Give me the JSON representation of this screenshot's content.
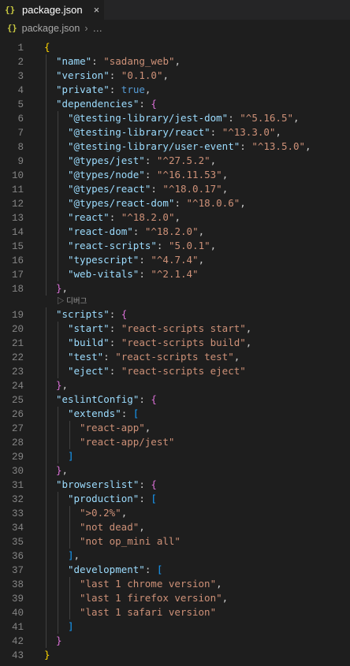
{
  "tab": {
    "icon": "{}",
    "title": "package.json",
    "close": "×"
  },
  "breadcrumb": {
    "icon": "{}",
    "file": "package.json",
    "separator": "›",
    "more": "…"
  },
  "codelens": "▷ 디버그",
  "colors": {
    "background": "#1e1e1e",
    "key": "#9cdcfe",
    "string": "#ce9178",
    "keyword": "#569cd6",
    "bracket_level1": "#ffd700",
    "bracket_level2": "#da70d6",
    "bracket_level3": "#179fff"
  },
  "lines": [
    {
      "n": "1",
      "indent": 0,
      "tokens": [
        [
          "b1",
          "{"
        ]
      ]
    },
    {
      "n": "2",
      "indent": 1,
      "tokens": [
        [
          "key",
          "\"name\""
        ],
        [
          "punc",
          ": "
        ],
        [
          "str",
          "\"sadang_web\""
        ],
        [
          "punc",
          ","
        ]
      ]
    },
    {
      "n": "3",
      "indent": 1,
      "tokens": [
        [
          "key",
          "\"version\""
        ],
        [
          "punc",
          ": "
        ],
        [
          "str",
          "\"0.1.0\""
        ],
        [
          "punc",
          ","
        ]
      ]
    },
    {
      "n": "4",
      "indent": 1,
      "tokens": [
        [
          "key",
          "\"private\""
        ],
        [
          "punc",
          ": "
        ],
        [
          "kw",
          "true"
        ],
        [
          "punc",
          ","
        ]
      ]
    },
    {
      "n": "5",
      "indent": 1,
      "tokens": [
        [
          "key",
          "\"dependencies\""
        ],
        [
          "punc",
          ": "
        ],
        [
          "b2",
          "{"
        ]
      ]
    },
    {
      "n": "6",
      "indent": 2,
      "tokens": [
        [
          "key",
          "\"@testing-library/jest-dom\""
        ],
        [
          "punc",
          ": "
        ],
        [
          "str",
          "\"^5.16.5\""
        ],
        [
          "punc",
          ","
        ]
      ]
    },
    {
      "n": "7",
      "indent": 2,
      "tokens": [
        [
          "key",
          "\"@testing-library/react\""
        ],
        [
          "punc",
          ": "
        ],
        [
          "str",
          "\"^13.3.0\""
        ],
        [
          "punc",
          ","
        ]
      ]
    },
    {
      "n": "8",
      "indent": 2,
      "tokens": [
        [
          "key",
          "\"@testing-library/user-event\""
        ],
        [
          "punc",
          ": "
        ],
        [
          "str",
          "\"^13.5.0\""
        ],
        [
          "punc",
          ","
        ]
      ]
    },
    {
      "n": "9",
      "indent": 2,
      "tokens": [
        [
          "key",
          "\"@types/jest\""
        ],
        [
          "punc",
          ": "
        ],
        [
          "str",
          "\"^27.5.2\""
        ],
        [
          "punc",
          ","
        ]
      ]
    },
    {
      "n": "10",
      "indent": 2,
      "tokens": [
        [
          "key",
          "\"@types/node\""
        ],
        [
          "punc",
          ": "
        ],
        [
          "str",
          "\"^16.11.53\""
        ],
        [
          "punc",
          ","
        ]
      ]
    },
    {
      "n": "11",
      "indent": 2,
      "tokens": [
        [
          "key",
          "\"@types/react\""
        ],
        [
          "punc",
          ": "
        ],
        [
          "str",
          "\"^18.0.17\""
        ],
        [
          "punc",
          ","
        ]
      ]
    },
    {
      "n": "12",
      "indent": 2,
      "tokens": [
        [
          "key",
          "\"@types/react-dom\""
        ],
        [
          "punc",
          ": "
        ],
        [
          "str",
          "\"^18.0.6\""
        ],
        [
          "punc",
          ","
        ]
      ]
    },
    {
      "n": "13",
      "indent": 2,
      "tokens": [
        [
          "key",
          "\"react\""
        ],
        [
          "punc",
          ": "
        ],
        [
          "str",
          "\"^18.2.0\""
        ],
        [
          "punc",
          ","
        ]
      ]
    },
    {
      "n": "14",
      "indent": 2,
      "tokens": [
        [
          "key",
          "\"react-dom\""
        ],
        [
          "punc",
          ": "
        ],
        [
          "str",
          "\"^18.2.0\""
        ],
        [
          "punc",
          ","
        ]
      ]
    },
    {
      "n": "15",
      "indent": 2,
      "tokens": [
        [
          "key",
          "\"react-scripts\""
        ],
        [
          "punc",
          ": "
        ],
        [
          "str",
          "\"5.0.1\""
        ],
        [
          "punc",
          ","
        ]
      ]
    },
    {
      "n": "16",
      "indent": 2,
      "tokens": [
        [
          "key",
          "\"typescript\""
        ],
        [
          "punc",
          ": "
        ],
        [
          "str",
          "\"^4.7.4\""
        ],
        [
          "punc",
          ","
        ]
      ]
    },
    {
      "n": "17",
      "indent": 2,
      "tokens": [
        [
          "key",
          "\"web-vitals\""
        ],
        [
          "punc",
          ": "
        ],
        [
          "str",
          "\"^2.1.4\""
        ]
      ]
    },
    {
      "n": "18",
      "indent": 1,
      "tokens": [
        [
          "b2",
          "}"
        ],
        [
          "punc",
          ","
        ]
      ],
      "lens_after": true
    },
    {
      "n": "19",
      "indent": 1,
      "tokens": [
        [
          "key",
          "\"scripts\""
        ],
        [
          "punc",
          ": "
        ],
        [
          "b2",
          "{"
        ]
      ]
    },
    {
      "n": "20",
      "indent": 2,
      "tokens": [
        [
          "key",
          "\"start\""
        ],
        [
          "punc",
          ": "
        ],
        [
          "str",
          "\"react-scripts start\""
        ],
        [
          "punc",
          ","
        ]
      ]
    },
    {
      "n": "21",
      "indent": 2,
      "tokens": [
        [
          "key",
          "\"build\""
        ],
        [
          "punc",
          ": "
        ],
        [
          "str",
          "\"react-scripts build\""
        ],
        [
          "punc",
          ","
        ]
      ]
    },
    {
      "n": "22",
      "indent": 2,
      "tokens": [
        [
          "key",
          "\"test\""
        ],
        [
          "punc",
          ": "
        ],
        [
          "str",
          "\"react-scripts test\""
        ],
        [
          "punc",
          ","
        ]
      ]
    },
    {
      "n": "23",
      "indent": 2,
      "tokens": [
        [
          "key",
          "\"eject\""
        ],
        [
          "punc",
          ": "
        ],
        [
          "str",
          "\"react-scripts eject\""
        ]
      ]
    },
    {
      "n": "24",
      "indent": 1,
      "tokens": [
        [
          "b2",
          "}"
        ],
        [
          "punc",
          ","
        ]
      ]
    },
    {
      "n": "25",
      "indent": 1,
      "tokens": [
        [
          "key",
          "\"eslintConfig\""
        ],
        [
          "punc",
          ": "
        ],
        [
          "b2",
          "{"
        ]
      ]
    },
    {
      "n": "26",
      "indent": 2,
      "tokens": [
        [
          "key",
          "\"extends\""
        ],
        [
          "punc",
          ": "
        ],
        [
          "b3",
          "["
        ]
      ]
    },
    {
      "n": "27",
      "indent": 3,
      "tokens": [
        [
          "str",
          "\"react-app\""
        ],
        [
          "punc",
          ","
        ]
      ]
    },
    {
      "n": "28",
      "indent": 3,
      "tokens": [
        [
          "str",
          "\"react-app/jest\""
        ]
      ]
    },
    {
      "n": "29",
      "indent": 2,
      "tokens": [
        [
          "b3",
          "]"
        ]
      ]
    },
    {
      "n": "30",
      "indent": 1,
      "tokens": [
        [
          "b2",
          "}"
        ],
        [
          "punc",
          ","
        ]
      ]
    },
    {
      "n": "31",
      "indent": 1,
      "tokens": [
        [
          "key",
          "\"browserslist\""
        ],
        [
          "punc",
          ": "
        ],
        [
          "b2",
          "{"
        ]
      ]
    },
    {
      "n": "32",
      "indent": 2,
      "tokens": [
        [
          "key",
          "\"production\""
        ],
        [
          "punc",
          ": "
        ],
        [
          "b3",
          "["
        ]
      ]
    },
    {
      "n": "33",
      "indent": 3,
      "tokens": [
        [
          "str",
          "\">0.2%\""
        ],
        [
          "punc",
          ","
        ]
      ]
    },
    {
      "n": "34",
      "indent": 3,
      "tokens": [
        [
          "str",
          "\"not dead\""
        ],
        [
          "punc",
          ","
        ]
      ]
    },
    {
      "n": "35",
      "indent": 3,
      "tokens": [
        [
          "str",
          "\"not op_mini all\""
        ]
      ]
    },
    {
      "n": "36",
      "indent": 2,
      "tokens": [
        [
          "b3",
          "]"
        ],
        [
          "punc",
          ","
        ]
      ]
    },
    {
      "n": "37",
      "indent": 2,
      "tokens": [
        [
          "key",
          "\"development\""
        ],
        [
          "punc",
          ": "
        ],
        [
          "b3",
          "["
        ]
      ]
    },
    {
      "n": "38",
      "indent": 3,
      "tokens": [
        [
          "str",
          "\"last 1 chrome version\""
        ],
        [
          "punc",
          ","
        ]
      ]
    },
    {
      "n": "39",
      "indent": 3,
      "tokens": [
        [
          "str",
          "\"last 1 firefox version\""
        ],
        [
          "punc",
          ","
        ]
      ]
    },
    {
      "n": "40",
      "indent": 3,
      "tokens": [
        [
          "str",
          "\"last 1 safari version\""
        ]
      ]
    },
    {
      "n": "41",
      "indent": 2,
      "tokens": [
        [
          "b3",
          "]"
        ]
      ]
    },
    {
      "n": "42",
      "indent": 1,
      "tokens": [
        [
          "b2",
          "}"
        ]
      ]
    },
    {
      "n": "43",
      "indent": 0,
      "tokens": [
        [
          "b1",
          "}"
        ]
      ]
    }
  ]
}
